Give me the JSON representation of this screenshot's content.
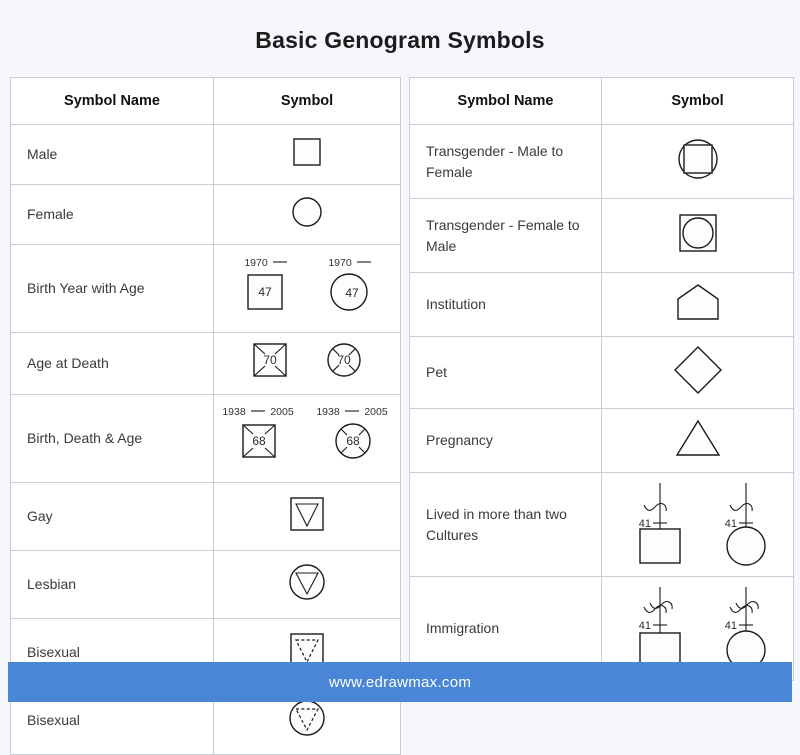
{
  "page": {
    "title": "Basic Genogram Symbols",
    "background_color": "#f6f7fc"
  },
  "footer": {
    "url": "www.edrawmax.com",
    "background_color": "#4a86d8",
    "text_color": "#ffffff"
  },
  "tables": {
    "left": {
      "headers": {
        "name": "Symbol Name",
        "symbol": "Symbol"
      },
      "rows": [
        {
          "name": "Male",
          "symbol": "square"
        },
        {
          "name": "Female",
          "symbol": "circle"
        },
        {
          "name": "Birth Year with Age",
          "symbol": "birth-year-with-age",
          "birth_year": "1970",
          "age": "47"
        },
        {
          "name": "Age at Death",
          "symbol": "age-at-death",
          "age": "70"
        },
        {
          "name": "Birth, Death & Age",
          "symbol": "birth-death-age",
          "birth_year": "1938",
          "death_year": "2005",
          "age": "68"
        },
        {
          "name": "Gay",
          "symbol": "square-with-triangle"
        },
        {
          "name": "Lesbian",
          "symbol": "circle-with-triangle"
        },
        {
          "name": "Bisexual",
          "symbol": "square-with-dashed-triangle"
        },
        {
          "name": "Bisexual",
          "symbol": "circle-with-dashed-triangle"
        }
      ]
    },
    "right": {
      "headers": {
        "name": "Symbol Name",
        "symbol": "Symbol"
      },
      "rows": [
        {
          "name": "Transgender - Male to Female",
          "symbol": "square-inside-circle"
        },
        {
          "name": "Transgender - Female to Male",
          "symbol": "circle-inside-square"
        },
        {
          "name": "Institution",
          "symbol": "pentagon-house"
        },
        {
          "name": "Pet",
          "symbol": "diamond"
        },
        {
          "name": "Pregnancy",
          "symbol": "triangle"
        },
        {
          "name": "Lived in more than two Cultures",
          "symbol": "single-wave-on-stem",
          "age": "41"
        },
        {
          "name": "Immigration",
          "symbol": "double-wave-on-stem",
          "age": "41"
        }
      ]
    }
  },
  "colors": {
    "stroke": "#1a1a1a",
    "border": "#c9cdd4",
    "cell_background": "#ffffff"
  }
}
